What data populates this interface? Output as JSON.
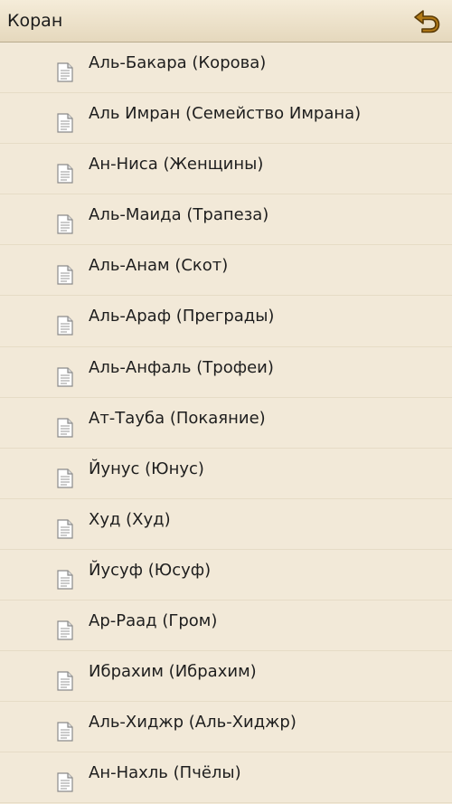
{
  "header": {
    "title": "Коран",
    "back_icon": "back-arrow-icon"
  },
  "colors": {
    "background": "#f2e9d8",
    "back_arrow": "#b27a17"
  },
  "surahs": [
    {
      "label": "Аль-Бакара (Корова)"
    },
    {
      "label": "Аль Имран (Семейство Имрана)"
    },
    {
      "label": "Ан-Ниса (Женщины)"
    },
    {
      "label": "Аль-Маида (Трапеза)"
    },
    {
      "label": "Аль-Анам (Скот)"
    },
    {
      "label": "Аль-Араф (Преграды)"
    },
    {
      "label": "Аль-Анфаль (Трофеи)"
    },
    {
      "label": "Ат-Тауба (Покаяние)"
    },
    {
      "label": "Йунус (Юнус)"
    },
    {
      "label": "Худ (Худ)"
    },
    {
      "label": "Йусуф (Юсуф)"
    },
    {
      "label": "Ар-Раад (Гром)"
    },
    {
      "label": "Ибрахим (Ибрахим)"
    },
    {
      "label": "Аль-Хиджр (Аль-Хиджр)"
    },
    {
      "label": "Ан-Нахль (Пчёлы)"
    }
  ]
}
